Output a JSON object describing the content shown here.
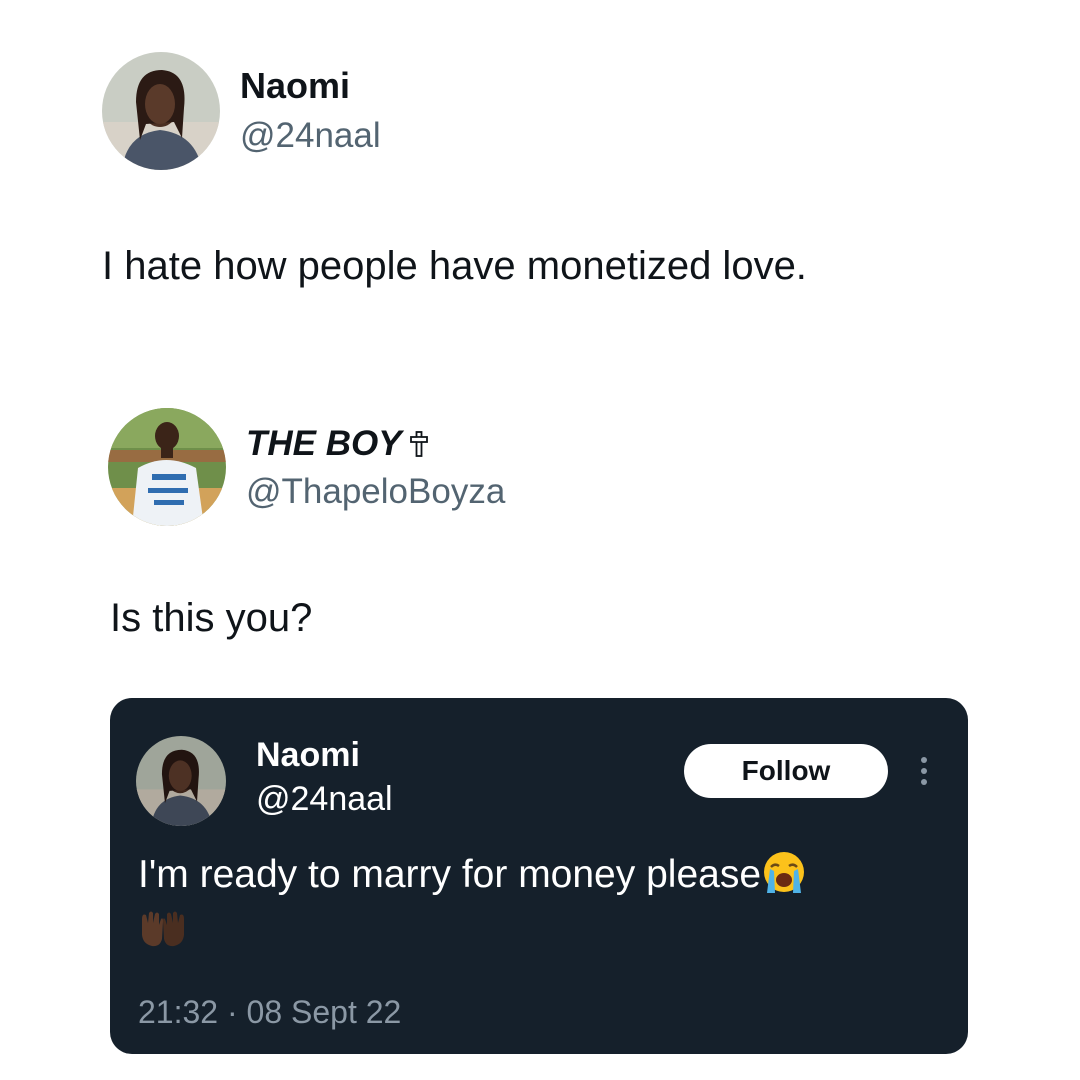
{
  "tweet1": {
    "name": "Naomi",
    "handle": "@24naal",
    "text": "I hate how people have monetized love."
  },
  "tweet2": {
    "name": "THE BOY",
    "name_icon": "latin-cross-icon",
    "handle": "@ThapeloBoyza",
    "text": "Is this you?"
  },
  "quoted_tweet": {
    "name": "Naomi",
    "handle": "@24naal",
    "follow_label": "Follow",
    "more_icon": "vertical-ellipsis-icon",
    "text": "I'm ready to marry for money please",
    "emoji_1": "crying-face-emoji",
    "emoji_2": "palms-up-together-emoji",
    "timestamp": "21:32 · 08 Sept 22",
    "background_color": "#15202b"
  }
}
